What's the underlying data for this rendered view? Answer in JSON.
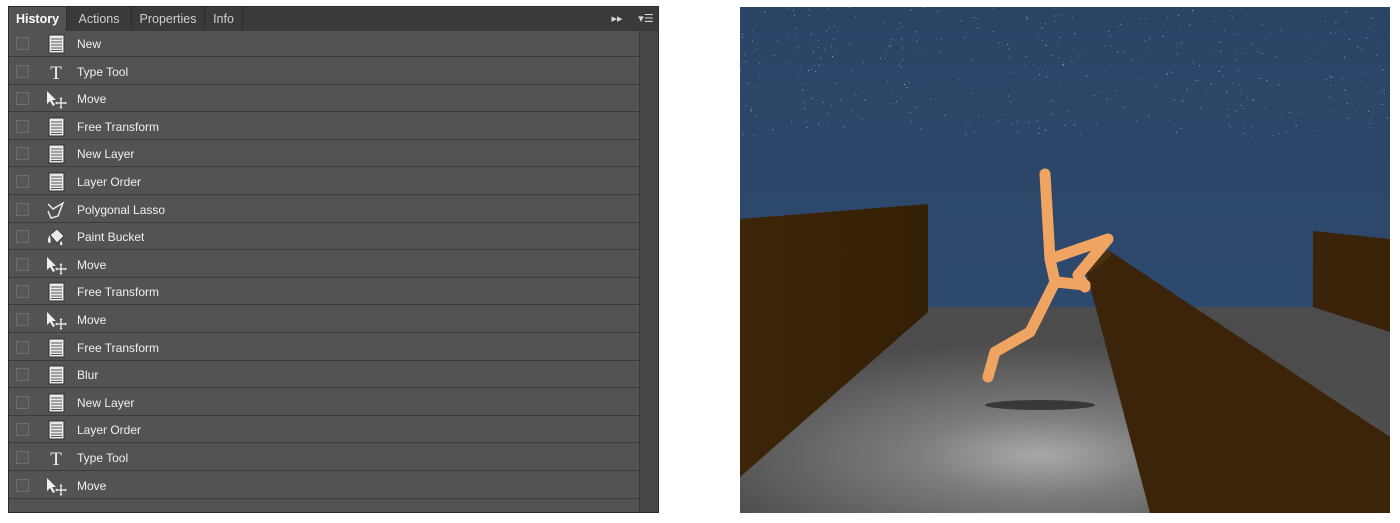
{
  "tabs": [
    {
      "label": "History",
      "active": true
    },
    {
      "label": "Actions",
      "active": false
    },
    {
      "label": "Properties",
      "active": false
    },
    {
      "label": "Info",
      "active": false
    }
  ],
  "panel_controls": {
    "collapse": "▸▸",
    "menu": "▾☰"
  },
  "history": [
    {
      "label": "New",
      "icon": "document-icon"
    },
    {
      "label": "Type Tool",
      "icon": "type-tool-icon"
    },
    {
      "label": "Move",
      "icon": "move-tool-icon"
    },
    {
      "label": "Free Transform",
      "icon": "document-icon"
    },
    {
      "label": "New Layer",
      "icon": "document-icon"
    },
    {
      "label": "Layer Order",
      "icon": "document-icon"
    },
    {
      "label": "Polygonal Lasso",
      "icon": "polygonal-lasso-icon"
    },
    {
      "label": "Paint Bucket",
      "icon": "paint-bucket-icon"
    },
    {
      "label": "Move",
      "icon": "move-tool-icon"
    },
    {
      "label": "Free Transform",
      "icon": "document-icon"
    },
    {
      "label": "Move",
      "icon": "move-tool-icon"
    },
    {
      "label": "Free Transform",
      "icon": "document-icon"
    },
    {
      "label": "Blur",
      "icon": "document-icon"
    },
    {
      "label": "New Layer",
      "icon": "document-icon"
    },
    {
      "label": "Layer Order",
      "icon": "document-icon"
    },
    {
      "label": "Type Tool",
      "icon": "type-tool-icon"
    },
    {
      "label": "Move",
      "icon": "move-tool-icon"
    }
  ],
  "colors": {
    "panel_bg": "#535353",
    "sky": "#2e4a6c",
    "wall": "#3a2208",
    "floor": "#5a5a5a",
    "figure": "#f0a463"
  }
}
